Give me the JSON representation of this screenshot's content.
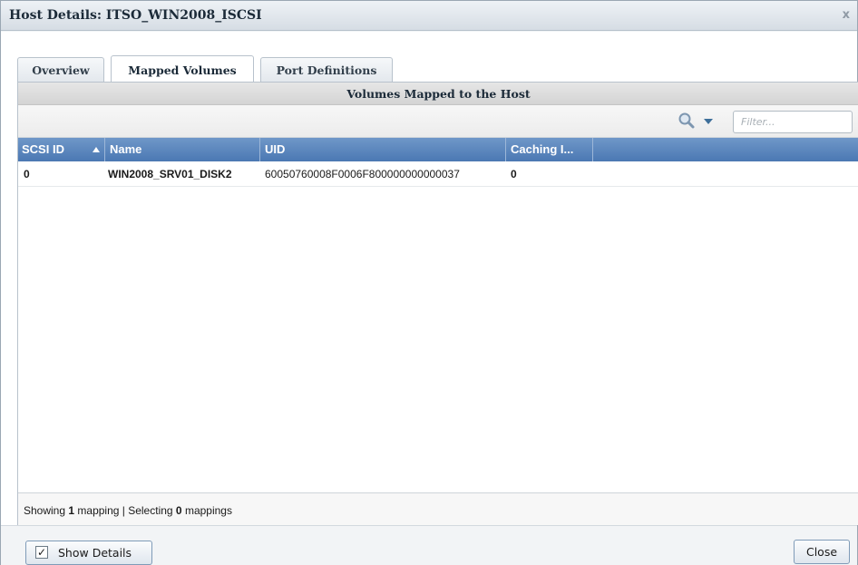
{
  "window": {
    "title": "Host Details: ITSO_WIN2008_ISCSI",
    "close_glyph": "x"
  },
  "tabs": [
    {
      "label": "Overview",
      "active": false
    },
    {
      "label": "Mapped Volumes",
      "active": true
    },
    {
      "label": "Port Definitions",
      "active": false
    }
  ],
  "panel": {
    "header": "Volumes Mapped to the Host"
  },
  "toolbar": {
    "filter_placeholder": "Filter...",
    "search_icon": "search-icon",
    "dropdown_icon": "chevron-down-icon"
  },
  "table": {
    "columns": [
      {
        "label": "SCSI ID",
        "sort": "ascending"
      },
      {
        "label": "Name"
      },
      {
        "label": "UID"
      },
      {
        "label": "Caching I..."
      }
    ],
    "rows": [
      {
        "scsi_id": "0",
        "name": "WIN2008_SRV01_DISK2",
        "uid": "60050760008F0006F800000000000037",
        "caching": "0"
      }
    ]
  },
  "status": {
    "prefix": "Showing ",
    "showing_count": "1",
    "mid": " mapping | Selecting ",
    "selecting_count": "0",
    "suffix": " mappings"
  },
  "footer": {
    "show_details_label": "Show Details",
    "show_details_checked": "✓",
    "close_label": "Close"
  },
  "colors": {
    "header_blue": "#4b78b3",
    "accent_border": "#7f9bb8"
  }
}
